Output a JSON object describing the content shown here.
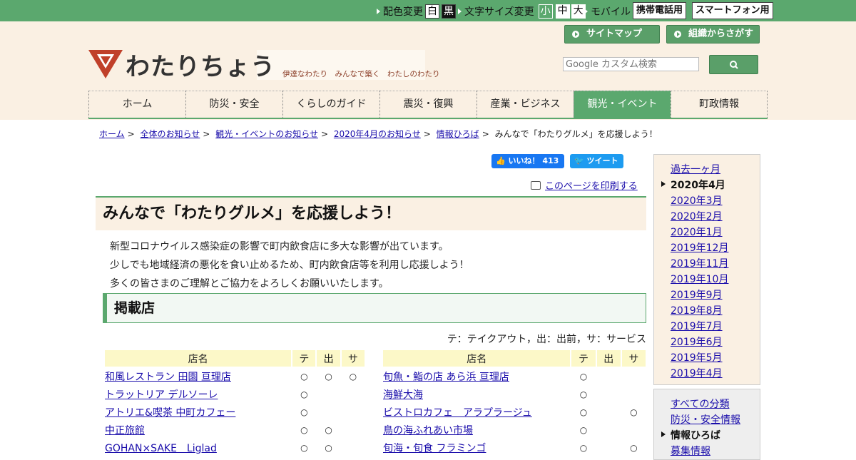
{
  "topbar": {
    "color_label": "配色変更",
    "color_white": "白",
    "color_black": "黒",
    "size_label": "文字サイズ変更",
    "size_small": "小",
    "size_mid": "中",
    "size_large": "大",
    "mobile_label": "モバイル",
    "mobile_btn": "携帯電話用",
    "smartphone_btn": "スマートフォン用"
  },
  "header": {
    "logo_text": "わたりちょう",
    "logo_tagline": "伊達なわたり　みんなで築く　わたしのわたり",
    "sitemap_btn": "サイトマップ",
    "org_btn": "組織からさがす",
    "search_placeholder": "Google カスタム検索"
  },
  "nav": [
    {
      "label": "ホーム"
    },
    {
      "label": "防災・安全"
    },
    {
      "label": "くらしのガイド"
    },
    {
      "label": "震災・復興"
    },
    {
      "label": "産業・ビジネス"
    },
    {
      "label": "観光・イベント"
    },
    {
      "label": "町政情報"
    }
  ],
  "breadcrumb": {
    "items": [
      "ホーム",
      "全体のお知らせ",
      "観光・イベントのお知らせ",
      "2020年4月のお知らせ",
      "情報ひろば"
    ],
    "current": "みんなで「わたりグルメ」を応援しよう！"
  },
  "social": {
    "like_label": "いいね！ 413",
    "tweet_label": "ツイート"
  },
  "print_label": "このページを印刷する",
  "article": {
    "title": "みんなで「わたりグルメ」を応援しよう！",
    "paragraphs": [
      "新型コロナウイルス感染症の影響で町内飲食店に多大な影響が出ています。",
      "少しでも地域経済の悪化を食い止めるため、町内飲食店等を利用し応援しよう！",
      "多くの皆さまのご理解とご協力をよろしくお願いいたします。"
    ],
    "section_heading": "掲載店",
    "legend": "テ：テイクアウト，出：出前，サ：サービス"
  },
  "table_headers": {
    "name": "店名",
    "te": "テ",
    "de": "出",
    "sa": "サ"
  },
  "shops_left": [
    {
      "name": "和風レストラン 田園 亘理店",
      "te": "○",
      "de": "○",
      "sa": "○"
    },
    {
      "name": "トラットリア デルソーレ",
      "te": "○",
      "de": "",
      "sa": ""
    },
    {
      "name": "アトリエ&喫茶 中町カフェー",
      "te": "○",
      "de": "",
      "sa": ""
    },
    {
      "name": "中正旅館",
      "te": "○",
      "de": "○",
      "sa": ""
    },
    {
      "name": "GOHAN×SAKE　Liglad",
      "te": "○",
      "de": "○",
      "sa": ""
    }
  ],
  "shops_right": [
    {
      "name": "旬魚・鮨の店 あら浜 亘理店",
      "te": "○",
      "de": "",
      "sa": ""
    },
    {
      "name": "海鮮大海",
      "te": "○",
      "de": "",
      "sa": ""
    },
    {
      "name": "ビストロカフェ　アラプラージュ",
      "te": "○",
      "de": "",
      "sa": "○"
    },
    {
      "name": "鳥の海ふれあい市場",
      "te": "○",
      "de": "",
      "sa": ""
    },
    {
      "name": "旬海・旬食 フラミンゴ",
      "te": "○",
      "de": "",
      "sa": "○"
    }
  ],
  "sidebar_months": [
    {
      "label": "過去一ヶ月",
      "current": false
    },
    {
      "label": "2020年4月",
      "current": true
    },
    {
      "label": "2020年3月",
      "current": false
    },
    {
      "label": "2020年2月",
      "current": false
    },
    {
      "label": "2020年1月",
      "current": false
    },
    {
      "label": "2019年12月",
      "current": false
    },
    {
      "label": "2019年11月",
      "current": false
    },
    {
      "label": "2019年10月",
      "current": false
    },
    {
      "label": "2019年9月",
      "current": false
    },
    {
      "label": "2019年8月",
      "current": false
    },
    {
      "label": "2019年7月",
      "current": false
    },
    {
      "label": "2019年6月",
      "current": false
    },
    {
      "label": "2019年5月",
      "current": false
    },
    {
      "label": "2019年4月",
      "current": false
    }
  ],
  "sidebar_categories": [
    {
      "label": "すべての分類",
      "current": false
    },
    {
      "label": "防災・安全情報",
      "current": false
    },
    {
      "label": "情報ひろば",
      "current": true
    },
    {
      "label": "募集情報",
      "current": false
    }
  ],
  "colors": {
    "accent_green": "#5ba86e",
    "header_cream": "#faf0e3",
    "link_blue": "#1a0dab"
  }
}
